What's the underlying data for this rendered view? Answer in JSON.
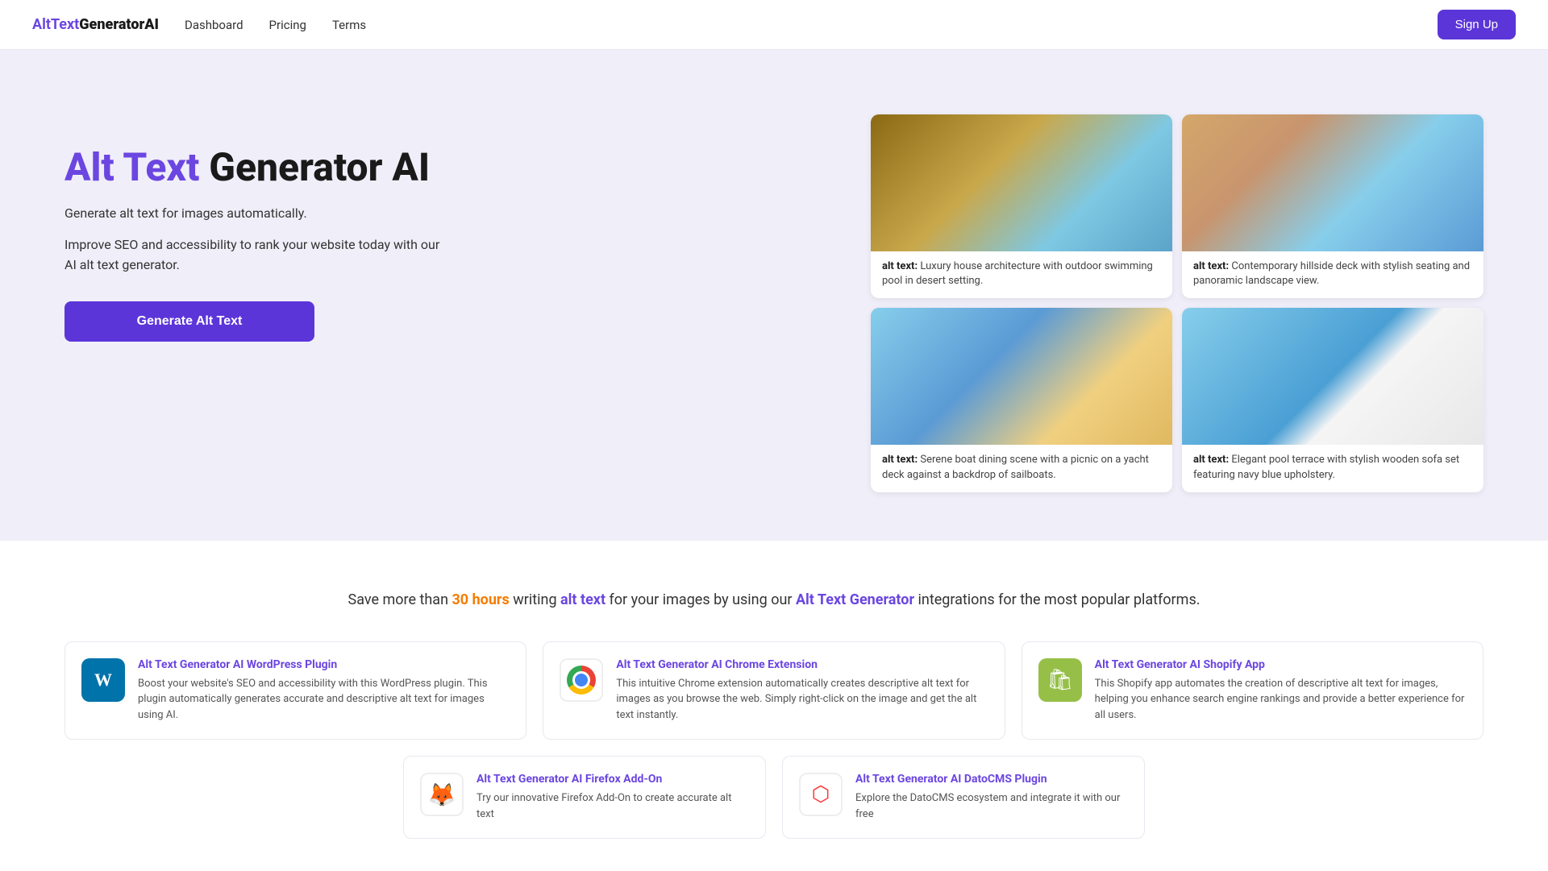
{
  "navbar": {
    "logo_alt": "Alt",
    "logo_main": "Text",
    "logo_bold": "GeneratorAI",
    "nav_links": [
      {
        "label": "Dashboard",
        "href": "#"
      },
      {
        "label": "Pricing",
        "href": "#"
      },
      {
        "label": "Terms",
        "href": "#"
      }
    ],
    "signup_label": "Sign Up"
  },
  "hero": {
    "title_purple": "Alt Text",
    "title_black": " Generator AI",
    "subtitle": "Generate alt text for images automatically.",
    "description": "Improve SEO and accessibility to rank your website today with our AI alt text generator.",
    "cta_label": "Generate Alt Text",
    "images": [
      {
        "alt_label": "alt text:",
        "alt_text": "Luxury house architecture with outdoor swimming pool in desert setting.",
        "style_class": "img-house"
      },
      {
        "alt_label": "alt text:",
        "alt_text": "Contemporary hillside deck with stylish seating and panoramic landscape view.",
        "style_class": "img-deck"
      },
      {
        "alt_label": "alt text:",
        "alt_text": "Serene boat dining scene with a picnic on a yacht deck against a backdrop of sailboats.",
        "style_class": "img-boat"
      },
      {
        "alt_label": "alt text:",
        "alt_text": "Elegant pool terrace with stylish wooden sofa set featuring navy blue upholstery.",
        "style_class": "img-pool"
      }
    ]
  },
  "integrations": {
    "header_prefix": "Save more than ",
    "hours": "30 hours",
    "header_middle": " writing ",
    "alt_text_link": "alt text",
    "header_middle2": " for your images by using our ",
    "generator_link": "Alt Text Generator",
    "header_suffix": " integrations for the most popular platforms.",
    "cards": [
      {
        "title": "Alt Text Generator AI WordPress Plugin",
        "description": "Boost your website's SEO and accessibility with this WordPress plugin. This plugin automatically generates accurate and descriptive alt text for images using AI.",
        "icon_type": "wp"
      },
      {
        "title": "Alt Text Generator AI Chrome Extension",
        "description": "This intuitive Chrome extension automatically creates descriptive alt text for images as you browse the web. Simply right-click on the image and get the alt text instantly.",
        "icon_type": "chrome"
      },
      {
        "title": "Alt Text Generator AI Shopify App",
        "description": "This Shopify app automates the creation of descriptive alt text for images, helping you enhance search engine rankings and provide a better experience for all users.",
        "icon_type": "shopify"
      }
    ],
    "cards_row2": [
      {
        "title": "Alt Text Generator AI Firefox Add-On",
        "description": "Try our innovative Firefox Add-On to create accurate alt text",
        "icon_type": "firefox"
      },
      {
        "title": "Alt Text Generator AI DatoCMS Plugin",
        "description": "Explore the DatoCMS ecosystem and integrate it with our free",
        "icon_type": "dato"
      }
    ]
  }
}
